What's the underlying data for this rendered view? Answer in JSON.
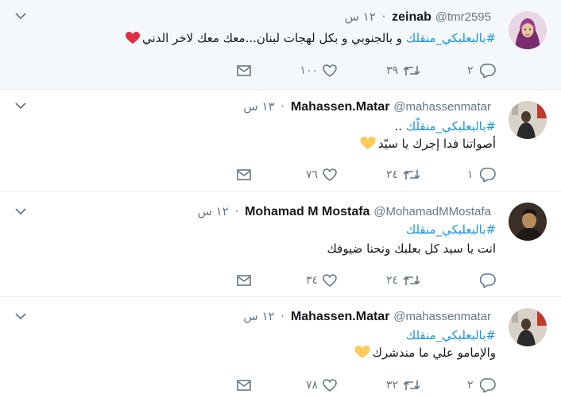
{
  "tweets": [
    {
      "name": "zeinab",
      "handle": "@tmr2595",
      "time": "١٢ س",
      "hashtag": "#بالبعلبكي_منقلك",
      "line1_rest": " و بالجنوبي و بكل لهجات لبنان...معك معك لاخر الدني",
      "line2": "",
      "emoji": "red-heart",
      "replies": "٢",
      "retweets": "٣٩",
      "likes": "١٠٠",
      "avatar": "woman-hijab-avatar"
    },
    {
      "name": "Mahassen.Matar",
      "handle": "@mahassenmatar",
      "time": "١٣ س",
      "hashtag": "#بالبعلبكي_منقلّك",
      "line1_rest": " ..",
      "line2": "أصواتنا فدا إجرك يا سيّد",
      "emoji": "yellow-heart",
      "replies": "١",
      "retweets": "٢٤",
      "likes": "٧٦",
      "avatar": "person-flags-avatar"
    },
    {
      "name": "Mohamad M Mostafa",
      "handle": "@MohamadMMostafa",
      "time": "١٢ س",
      "hashtag": "#بالبعلبكي_منقلك",
      "line1_rest": "",
      "line2": "انت يا سيد كل بعلبك ونحنا ضيوفك",
      "emoji": "",
      "replies": "",
      "retweets": "٢٤",
      "likes": "٣٤",
      "avatar": "man-dark-avatar"
    },
    {
      "name": "Mahassen.Matar",
      "handle": "@mahassenmatar",
      "time": "١٢ س",
      "hashtag": "#بالبعلبكي_منقلك",
      "line1_rest": "",
      "line2": "والإمامو علي ما مندشرك",
      "emoji": "yellow-heart",
      "replies": "٢",
      "retweets": "٣٢",
      "likes": "٧٨",
      "avatar": "person-flags-avatar"
    }
  ],
  "colors": {
    "hashtag": "#1b95e0",
    "meta": "#657786",
    "highlight_bg": "#f5f8fa",
    "red_heart": "#dd2e44",
    "yellow_heart": "#fdcb58"
  },
  "icons": [
    "reply-icon",
    "retweet-icon",
    "like-icon",
    "dm-icon",
    "chevron-down-icon"
  ]
}
